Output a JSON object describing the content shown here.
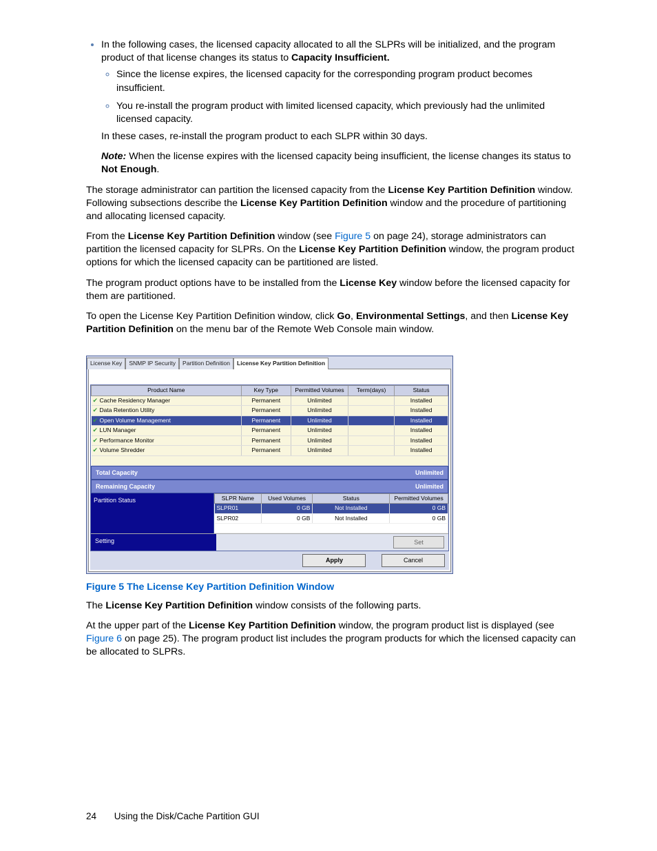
{
  "bullets": {
    "b1": "In the following cases, the licensed capacity allocated to all the SLPRs will be initialized, and the program product of that license changes its status to ",
    "b1_bold": "Capacity Insufficient.",
    "b1a": "Since the license expires, the licensed capacity for the corresponding program product becomes insufficient.",
    "b1b": "You re-install the program product with limited licensed capacity, which previously had the unlimited licensed capacity.",
    "b1_after1": "In these cases, re-install the program product to each SLPR within 30 days.",
    "b1_note_label": "Note:",
    "b1_note": " When the license expires with the licensed capacity being insufficient, the license changes its status to ",
    "b1_note_bold": "Not Enough",
    "b1_note_end": "."
  },
  "para": {
    "p1a": "The storage administrator can partition the licensed capacity from the ",
    "p1b": "License Key Partition Definition",
    "p1c": " window. Following subsections describe the ",
    "p1d": "License Key Partition Definition",
    "p1e": " window and the procedure of partitioning and allocating licensed capacity.",
    "p2a": "From the ",
    "p2b": "License Key Partition Definition",
    "p2c": " window (see ",
    "p2link": "Figure 5",
    "p2d": " on page 24), storage administrators can partition the licensed capacity for SLPRs. On the ",
    "p2e": "License Key Partition Definition",
    "p2f": " window, the program product options for which the licensed capacity can be partitioned are listed.",
    "p3a": "The program product options have to be installed from the ",
    "p3b": "License Key",
    "p3c": " window before the licensed capacity for them are partitioned.",
    "p4a": "To open the License Key Partition Definition window, click ",
    "p4b": "Go",
    "p4c": ", ",
    "p4d": "Environmental Settings",
    "p4e": ", and then ",
    "p4f": "License Key Partition Definition",
    "p4g": " on the menu bar of the Remote Web Console main window."
  },
  "ss": {
    "tabs": {
      "t1": "License Key",
      "t2": "SNMP IP Security",
      "t3": "Partition Definition",
      "t4": "License Key Partition Definition"
    },
    "cols": {
      "c1": "Product Name",
      "c2": "Key Type",
      "c3": "Permitted Volumes",
      "c4": "Term(days)",
      "c5": "Status"
    },
    "rows": [
      {
        "name": "Cache Residency Manager",
        "key": "Permanent",
        "perm": "Unlimited",
        "term": "",
        "status": "Installed",
        "sel": false
      },
      {
        "name": "Data Retention Utility",
        "key": "Permanent",
        "perm": "Unlimited",
        "term": "",
        "status": "Installed",
        "sel": false
      },
      {
        "name": "Open Volume Management",
        "key": "Permanent",
        "perm": "Unlimited",
        "term": "",
        "status": "Installed",
        "sel": true
      },
      {
        "name": "LUN Manager",
        "key": "Permanent",
        "perm": "Unlimited",
        "term": "",
        "status": "Installed",
        "sel": false
      },
      {
        "name": "Performance Monitor",
        "key": "Permanent",
        "perm": "Unlimited",
        "term": "",
        "status": "Installed",
        "sel": false
      },
      {
        "name": "Volume Shredder",
        "key": "Permanent",
        "perm": "Unlimited",
        "term": "",
        "status": "Installed",
        "sel": false
      }
    ],
    "bands": {
      "total_l": "Total Capacity",
      "total_r": "Unlimited",
      "remain_l": "Remaining Capacity",
      "remain_r": "Unlimited"
    },
    "partition": {
      "label": "Partition Status",
      "cols": {
        "c1": "SLPR Name",
        "c2": "Used Volumes",
        "c3": "Status",
        "c4": "Permitted Volumes"
      },
      "rows": [
        {
          "name": "SLPR01",
          "used": "0 GB",
          "status": "Not Installed",
          "perm": "0 GB",
          "sel": true
        },
        {
          "name": "SLPR02",
          "used": "0 GB",
          "status": "Not Installed",
          "perm": "0 GB",
          "sel": false
        }
      ]
    },
    "setting_label": "Setting",
    "btn_set": "Set",
    "btn_apply": "Apply",
    "btn_cancel": "Cancel"
  },
  "figcap": "Figure 5 The License Key Partition Definition Window",
  "after": {
    "a1a": "The ",
    "a1b": "License Key Partition Definition",
    "a1c": " window consists of the following parts.",
    "a2a": "At the upper part of the ",
    "a2b": "License Key Partition Definition",
    "a2c": " window, the program product list is displayed (see ",
    "a2link": "Figure 6",
    "a2d": " on page 25). The program product list includes the program products for which the licensed capacity can be allocated to SLPRs."
  },
  "footer": {
    "page": "24",
    "section": "Using the Disk/Cache Partition GUI"
  }
}
